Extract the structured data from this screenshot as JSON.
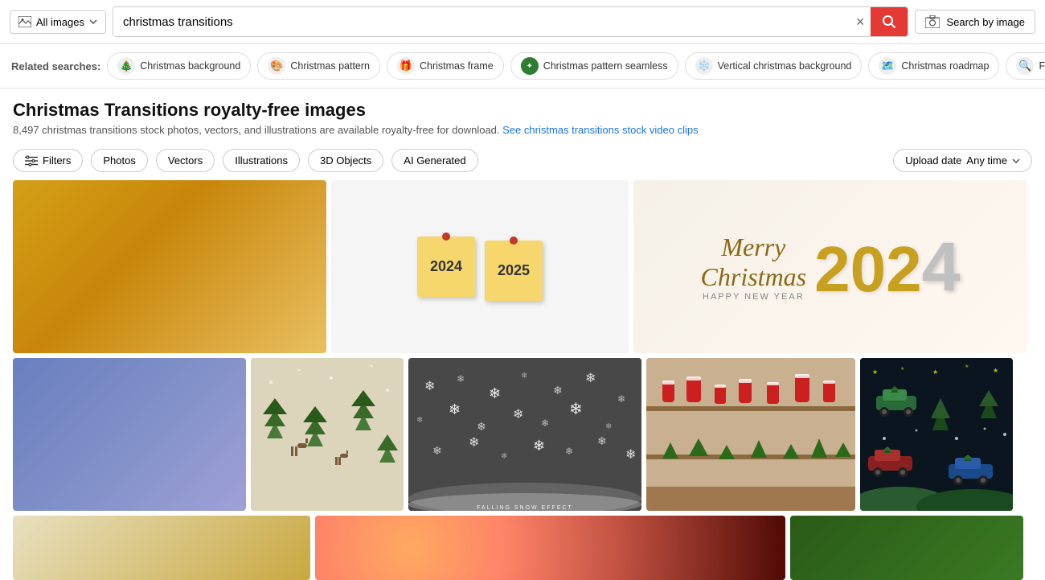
{
  "search": {
    "all_images_label": "All images",
    "query": "christmas transitions",
    "clear_label": "×",
    "search_by_image_label": "Search by image"
  },
  "related_searches": {
    "label": "Related searches:",
    "items": [
      {
        "id": "christmas-background",
        "label": "Christmas background",
        "icon": "🎄"
      },
      {
        "id": "christmas-pattern",
        "label": "Christmas pattern",
        "icon": "🎨"
      },
      {
        "id": "christmas-frame",
        "label": "Christmas frame",
        "icon": "🎁"
      },
      {
        "id": "christmas-pattern-seamless",
        "label": "Christmas pattern seamless",
        "icon": "🟢"
      },
      {
        "id": "vertical-christmas-background",
        "label": "Vertical christmas background",
        "icon": "❄️"
      },
      {
        "id": "christmas-roadmap",
        "label": "Christmas roadmap",
        "icon": "🗺️"
      },
      {
        "id": "fibers",
        "label": "Fibers",
        "icon": "🔍"
      }
    ]
  },
  "page_title": "Christmas Transitions royalty-free images",
  "page_subtitle": "8,497 christmas transitions stock photos, vectors, and illustrations are available royalty-free for download.",
  "video_link": "See christmas transitions stock video clips",
  "filters": {
    "main_label": "Filters",
    "options": [
      "Photos",
      "Vectors",
      "Illustrations",
      "3D Objects",
      "AI Generated"
    ],
    "upload_date_label": "Upload date",
    "upload_date_value": "Any time"
  },
  "images": {
    "row1": [
      {
        "id": "img1",
        "type": "gold",
        "alt": "Gold gradient background"
      },
      {
        "id": "img2",
        "type": "notes",
        "alt": "2024 to 2025 sticky notes transition",
        "year1": "2024",
        "year2": "2025"
      },
      {
        "id": "img3",
        "type": "christmas",
        "alt": "Merry Christmas Happy New Year 2024 balloon numbers"
      }
    ],
    "row2": [
      {
        "id": "img4",
        "type": "blue",
        "alt": "Blue gradient background"
      },
      {
        "id": "img5",
        "type": "deer",
        "alt": "Christmas deer pattern seamless"
      },
      {
        "id": "img6",
        "type": "snowflakes",
        "alt": "Falling snow effect",
        "label": "FALLING SNOW EFFECT"
      },
      {
        "id": "img7",
        "type": "santa_shelf",
        "alt": "Santa figures on shelf in store"
      },
      {
        "id": "img8",
        "type": "car_pattern",
        "alt": "Christmas cars with trees pattern"
      }
    ],
    "row3": [
      {
        "id": "img9",
        "type": "bottom_gold",
        "alt": "Gold transition"
      },
      {
        "id": "img10",
        "type": "bottom_bokeh",
        "alt": "Bokeh lights"
      },
      {
        "id": "img11",
        "type": "bottom_green",
        "alt": "Christmas green"
      }
    ]
  }
}
